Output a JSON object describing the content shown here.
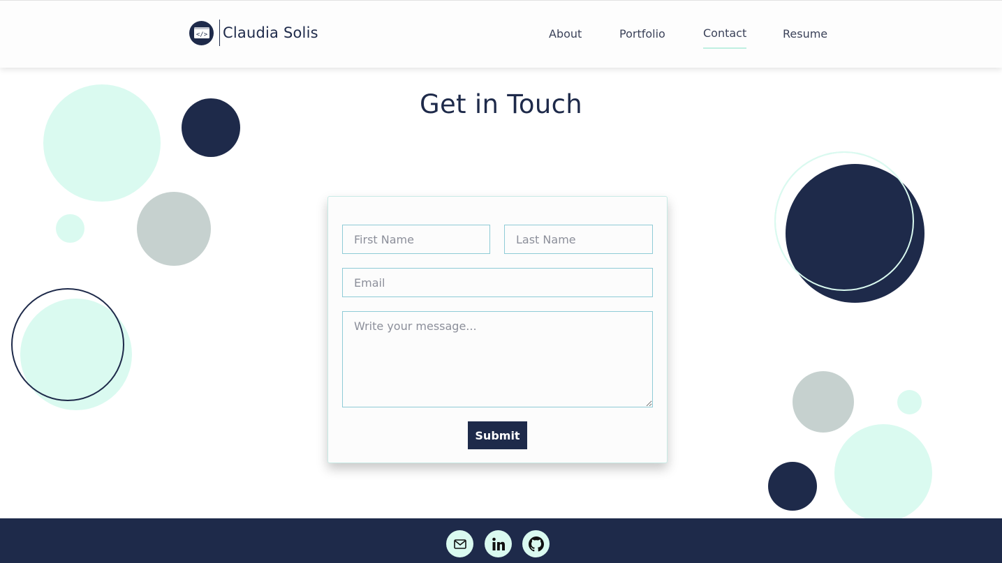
{
  "header": {
    "brand_name": "Claudia Solis",
    "logo_icon": "code-brackets-icon",
    "nav": [
      {
        "label": "About",
        "active": false
      },
      {
        "label": "Portfolio",
        "active": false
      },
      {
        "label": "Contact",
        "active": true
      },
      {
        "label": "Resume",
        "active": false
      }
    ]
  },
  "main": {
    "title": "Get in Touch"
  },
  "form": {
    "first_name_placeholder": "First Name",
    "last_name_placeholder": "Last Name",
    "email_placeholder": "Email",
    "message_placeholder": "Write your message...",
    "submit_label": "Submit"
  },
  "footer": {
    "social_icons": [
      "mail-icon",
      "linkedin-icon",
      "github-icon"
    ]
  },
  "colors": {
    "navy": "#1e2a4a",
    "mint": "#dafaf0",
    "grey": "#c6d1cf",
    "input_border": "#8ecbd6"
  }
}
